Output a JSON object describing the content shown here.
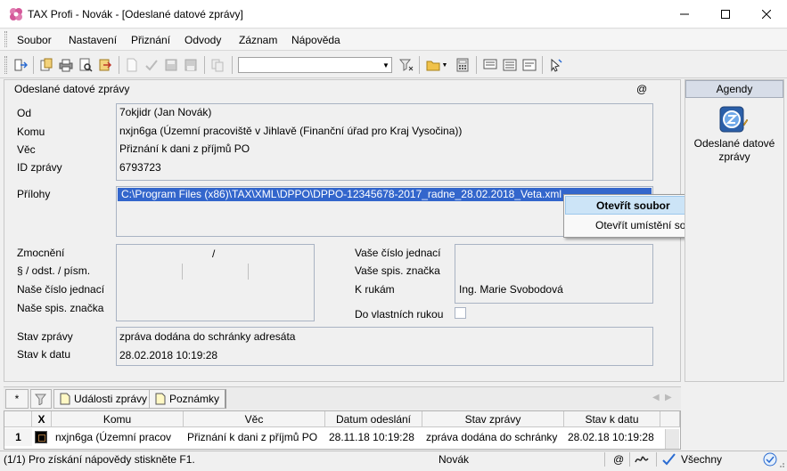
{
  "window": {
    "title": "TAX Profi - Novák - [Odeslané datové zprávy]"
  },
  "menu": {
    "soubor": "Soubor",
    "nastaveni": "Nastavení",
    "priznani": "Přiznání",
    "odvody": "Odvody",
    "zaznam": "Záznam",
    "napoveda": "Nápověda"
  },
  "toolbar": {
    "combo_value": ""
  },
  "panel": {
    "title": "Odeslané datové zprávy",
    "at_symbol": "@",
    "od_label": "Od",
    "od_value": "7okjidr (Jan Novák)",
    "komu_label": "Komu",
    "komu_value": "nxjn6ga (Územní pracoviště v Jihlavě (Finanční úřad pro Kraj Vysočina))",
    "vec_label": "Věc",
    "vec_value": "Přiznání k dani z příjmů PO",
    "id_label": "ID zprávy",
    "id_value": "6793723",
    "prilohy_label": "Přílohy",
    "prilohy_value": "C:\\Program Files (x86)\\TAX\\XML\\DPPO\\DPPO-12345678-2017_radne_28.02.2018_Veta.xml",
    "zmocneni_label": "Zmocnění",
    "zmocneni_slash": "/",
    "paragraf_label": "§ / odst. / písm.",
    "nase_cj_label": "Naše číslo jednací",
    "nase_sz_label": "Naše spis. značka",
    "vase_cj_label": "Vaše číslo jednací",
    "vase_sz_label": "Vaše spis. značka",
    "k_rukam_label": "K rukám",
    "k_rukam_value": "Ing. Marie Svobodová",
    "do_vlastnich_label": "Do vlastních rukou",
    "stav_label": "Stav zprávy",
    "stav_value": "zpráva dodána do schránky adresáta",
    "stav_datum_label": "Stav k datu",
    "stav_datum_value": "28.02.2018 10:19:28"
  },
  "context_menu": {
    "open_file": "Otevřít soubor",
    "open_location": "Otevřít umístění souboru"
  },
  "agendy": {
    "title": "Agendy",
    "item_label": "Odeslané datové zprávy"
  },
  "tabs": {
    "star": "*",
    "udalosti": "Události zprávy",
    "poznamky": "Poznámky"
  },
  "grid": {
    "headers": {
      "x": "X",
      "komu": "Komu",
      "vec": "Věc",
      "datum": "Datum odeslání",
      "stav": "Stav zprávy",
      "stav_datu": "Stav k datu"
    },
    "rows": [
      {
        "num": "1",
        "komu": "nxjn6ga (Územní pracov",
        "vec": "Přiznání k dani z příjmů PO",
        "datum": "28.11.18 10:19:28",
        "stav": "zpráva dodána do schránky",
        "stav_datu": "28.02.18 10:19:28"
      }
    ]
  },
  "status": {
    "help": "(1/1)  Pro získání nápovědy stiskněte F1.",
    "user": "Novák",
    "at": "@",
    "filter": "Všechny"
  }
}
